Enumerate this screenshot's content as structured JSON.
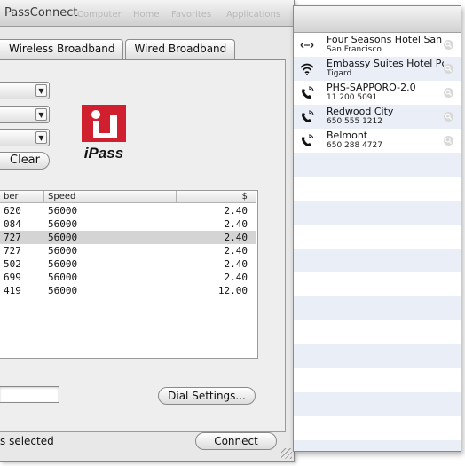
{
  "window": {
    "title": "PassConnect",
    "menu_ghost": [
      "Computer",
      "Home",
      "Favorites",
      "Applications"
    ]
  },
  "tabs": [
    {
      "label": "Wireless Broadband",
      "active": false
    },
    {
      "label": "Wired Broadband",
      "active": false
    }
  ],
  "filters": {
    "popups": [
      "",
      "",
      ""
    ],
    "clear_label": "Clear"
  },
  "logo": {
    "text": "iPass"
  },
  "numbers_table": {
    "headers": [
      "ber",
      "Speed",
      "$"
    ],
    "rows": [
      {
        "number": "620",
        "speed": "56000",
        "price": "2.40",
        "selected": false
      },
      {
        "number": "084",
        "speed": "56000",
        "price": "2.40",
        "selected": false
      },
      {
        "number": "727",
        "speed": "56000",
        "price": "2.40",
        "selected": true
      },
      {
        "number": "727",
        "speed": "56000",
        "price": "2.40",
        "selected": false
      },
      {
        "number": "502",
        "speed": "56000",
        "price": "2.40",
        "selected": false
      },
      {
        "number": "699",
        "speed": "56000",
        "price": "2.40",
        "selected": false
      },
      {
        "number": "419",
        "speed": "56000",
        "price": "12.00",
        "selected": false
      }
    ]
  },
  "dial_settings_label": "Dial Settings...",
  "status_text": "s selected",
  "connect_label": "Connect",
  "side_list": [
    {
      "name": "Four Seasons Hotel San",
      "sub": "San Francisco",
      "icon": "ethernet-icon"
    },
    {
      "name": "Embassy Suites Hotel Pc",
      "sub": "Tigard",
      "icon": "wifi-icon"
    },
    {
      "name": "PHS-SAPPORO-2.0",
      "sub": "11 200 5091",
      "icon": "phone-icon"
    },
    {
      "name": "Redwood City",
      "sub": "650 555 1212",
      "icon": "phone-icon"
    },
    {
      "name": "Belmont",
      "sub": "650 288 4727",
      "icon": "phone-icon"
    }
  ],
  "colors": {
    "logo_red": "#d01f2f",
    "stripe_blue": "#e9eef7",
    "selected_row": "#d4d4d4"
  }
}
